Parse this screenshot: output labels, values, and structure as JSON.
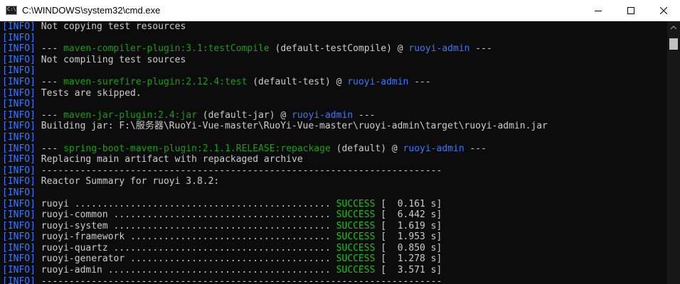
{
  "window": {
    "title": "C:\\WINDOWS\\system32\\cmd.exe",
    "icon_glyph": "C:\\",
    "icon_name": "cmd-icon",
    "controls": [
      "minimize-icon",
      "maximize-icon",
      "close-icon"
    ]
  },
  "console": {
    "colors": {
      "background": "#0c0c0c",
      "text": "#cccccc",
      "info_tag": "#3b78ff",
      "plugin": "#13a10e",
      "module": "#3b78ff",
      "success": "#16c60c"
    },
    "lines": [
      {
        "tag": "[INFO]",
        "text": " Not copying test resources"
      },
      {
        "tag": "[INFO]",
        "text": ""
      },
      {
        "tag": "[INFO]",
        "text": " --- ",
        "plugin": "maven-compiler-plugin:3.1:testCompile",
        "goal": " (default-testCompile) @ ",
        "module": "ruoyi-admin",
        "tail": " ---"
      },
      {
        "tag": "[INFO]",
        "text": " Not compiling test sources"
      },
      {
        "tag": "[INFO]",
        "text": ""
      },
      {
        "tag": "[INFO]",
        "text": " --- ",
        "plugin": "maven-surefire-plugin:2.12.4:test",
        "goal": " (default-test) @ ",
        "module": "ruoyi-admin",
        "tail": " ---"
      },
      {
        "tag": "[INFO]",
        "text": " Tests are skipped."
      },
      {
        "tag": "[INFO]",
        "text": ""
      },
      {
        "tag": "[INFO]",
        "text": " --- ",
        "plugin": "maven-jar-plugin:2.4:jar",
        "goal": " (default-jar) @ ",
        "module": "ruoyi-admin",
        "tail": " ---"
      },
      {
        "tag": "[INFO]",
        "text": " Building jar: F:\\服务器\\RuoYi-Vue-master\\RuoYi-Vue-master\\ruoyi-admin\\target\\ruoyi-admin.jar"
      },
      {
        "tag": "[INFO]",
        "text": ""
      },
      {
        "tag": "[INFO]",
        "text": " --- ",
        "plugin": "spring-boot-maven-plugin:2.1.1.RELEASE:repackage",
        "goal": " (default) @ ",
        "module": "ruoyi-admin",
        "tail": " ---"
      },
      {
        "tag": "[INFO]",
        "text": " Replacing main artifact with repackaged archive"
      },
      {
        "tag": "[INFO]",
        "text": " ------------------------------------------------------------------------"
      },
      {
        "tag": "[INFO]",
        "text": " Reactor Summary for ruoyi 3.8.2:"
      },
      {
        "tag": "[INFO]",
        "text": ""
      },
      {
        "tag": "[INFO]",
        "text": " ruoyi .............................................. ",
        "status": "SUCCESS",
        "time": " [  0.161 s]"
      },
      {
        "tag": "[INFO]",
        "text": " ruoyi-common ....................................... ",
        "status": "SUCCESS",
        "time": " [  6.442 s]"
      },
      {
        "tag": "[INFO]",
        "text": " ruoyi-system ....................................... ",
        "status": "SUCCESS",
        "time": " [  1.619 s]"
      },
      {
        "tag": "[INFO]",
        "text": " ruoyi-framework .................................... ",
        "status": "SUCCESS",
        "time": " [  1.953 s]"
      },
      {
        "tag": "[INFO]",
        "text": " ruoyi-quartz ....................................... ",
        "status": "SUCCESS",
        "time": " [  0.850 s]"
      },
      {
        "tag": "[INFO]",
        "text": " ruoyi-generator .................................... ",
        "status": "SUCCESS",
        "time": " [  1.278 s]"
      },
      {
        "tag": "[INFO]",
        "text": " ruoyi-admin ........................................ ",
        "status": "SUCCESS",
        "time": " [  3.571 s]"
      },
      {
        "tag": "[INFO]",
        "text": " ------------------------------------------------------------------------"
      }
    ]
  },
  "scrollbar": {
    "up_icon": "chevron-up-icon"
  }
}
